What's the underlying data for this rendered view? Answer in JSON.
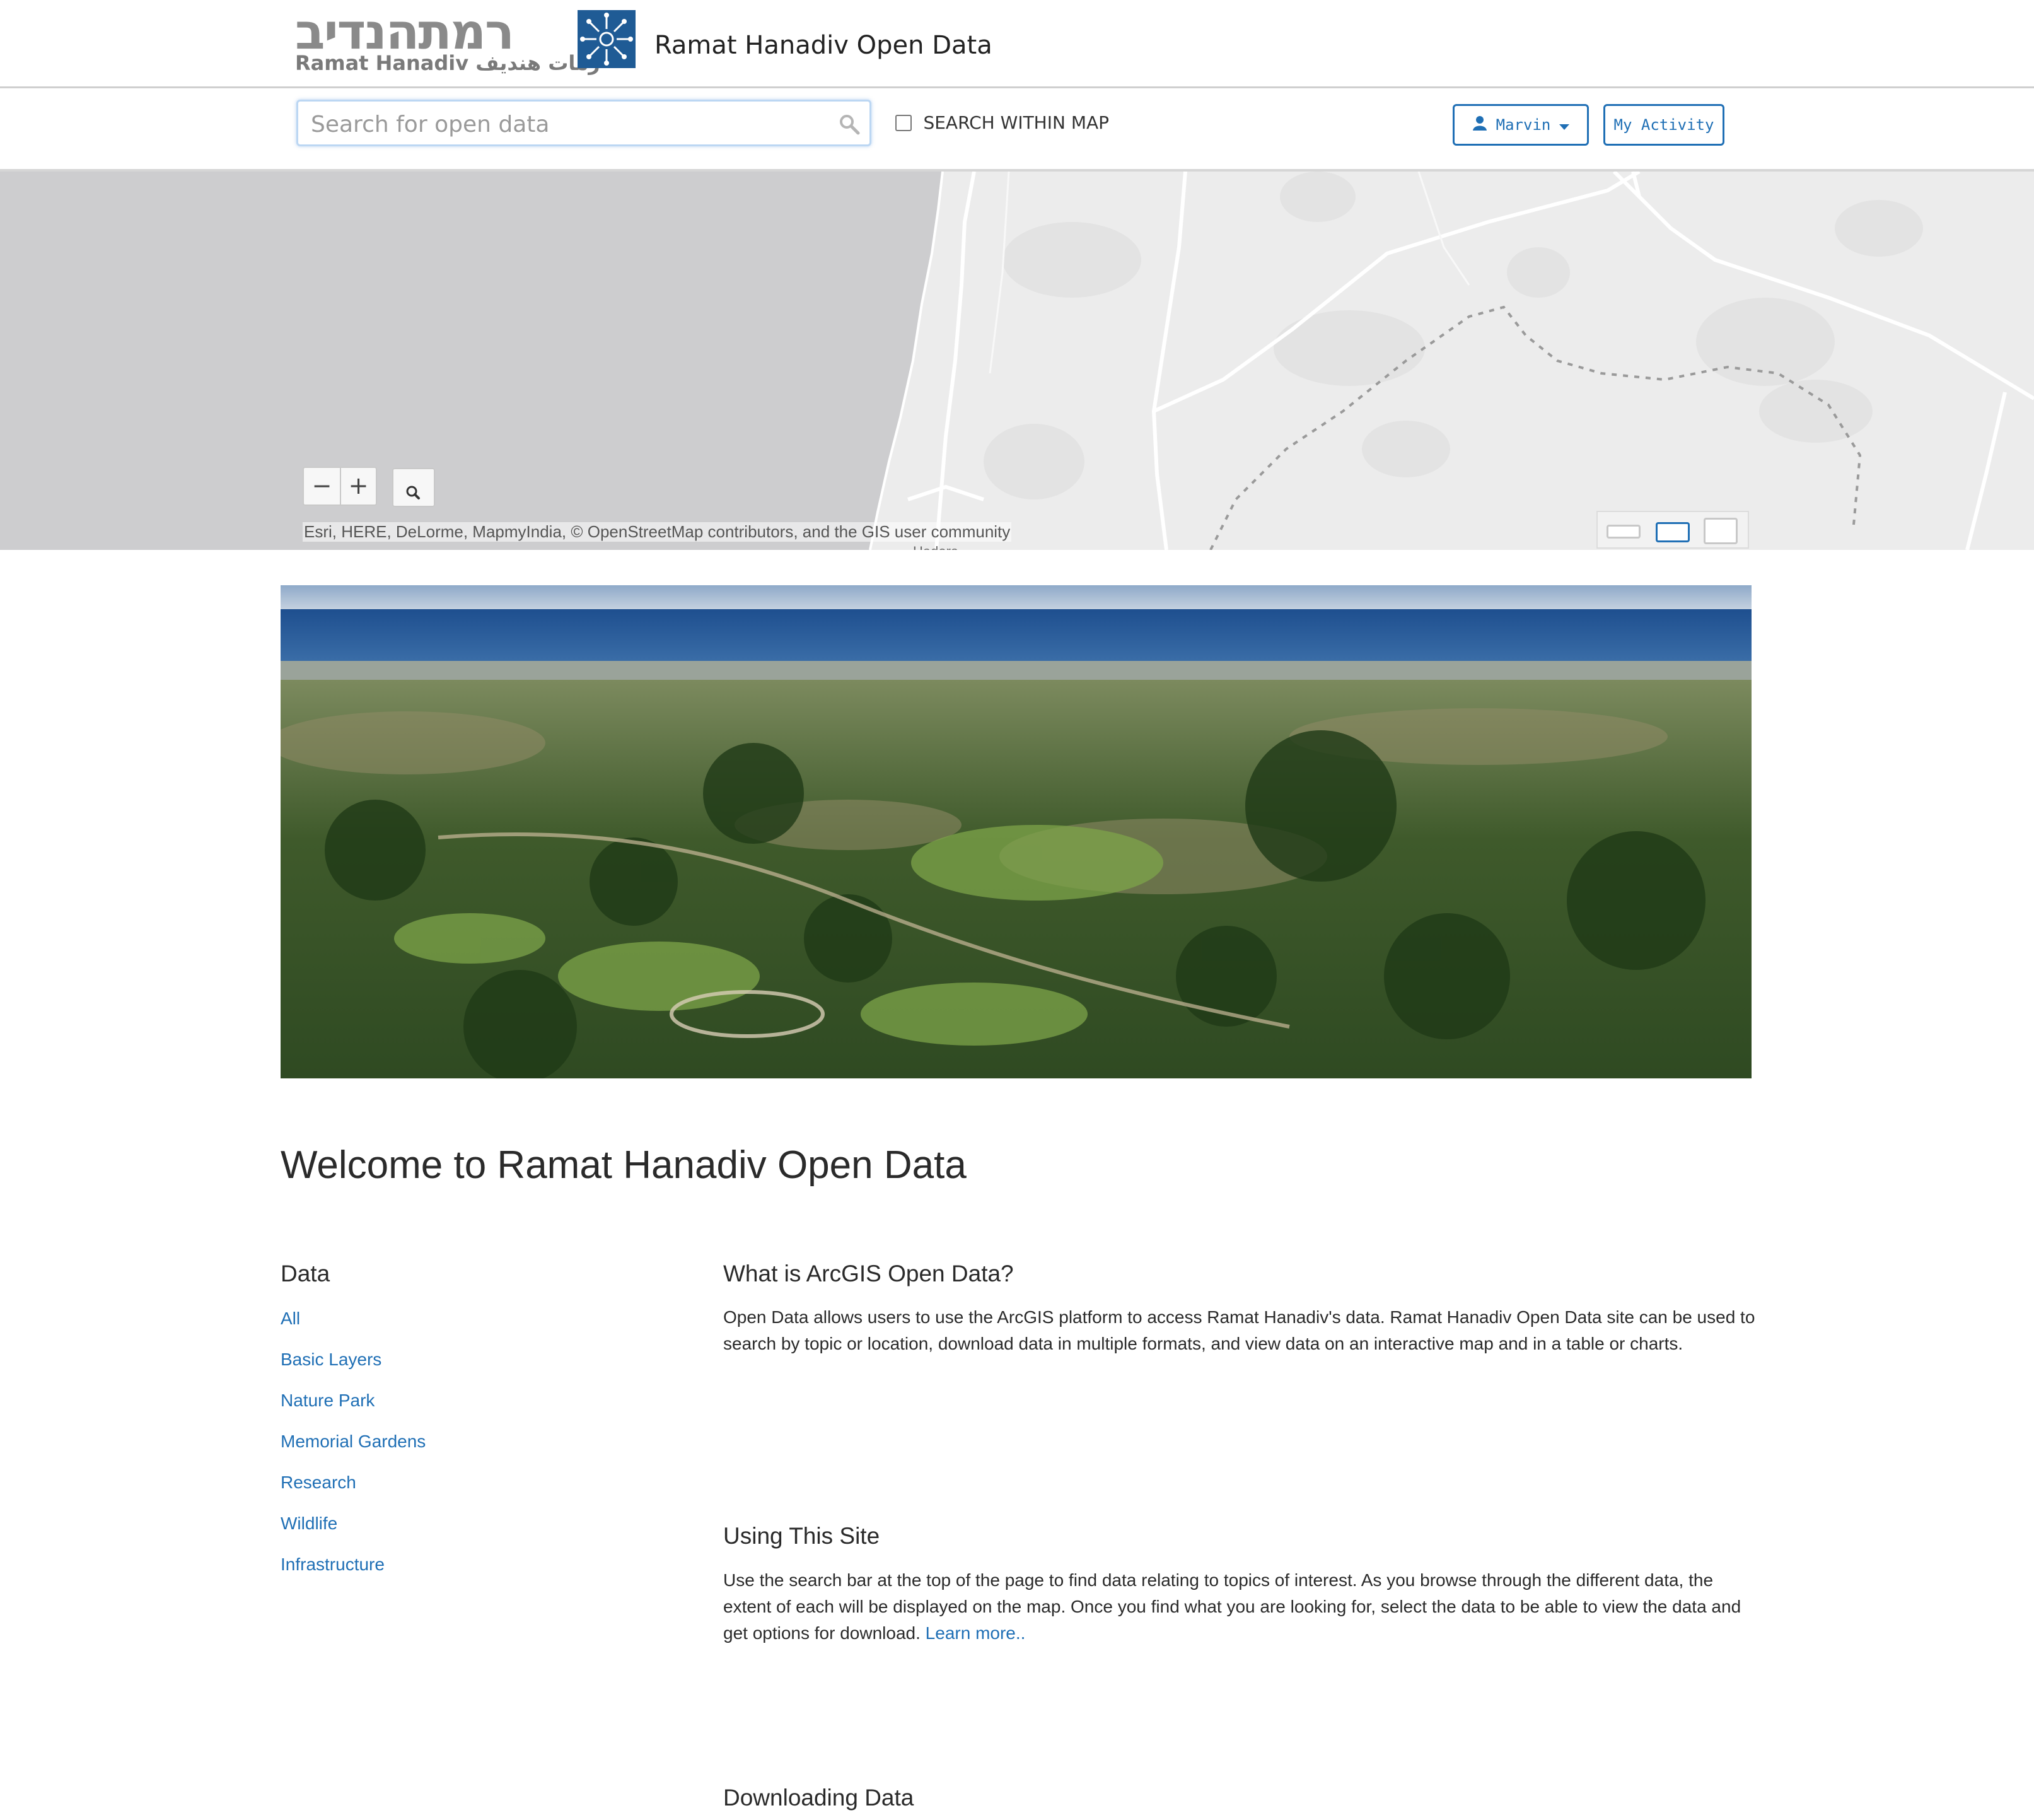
{
  "header": {
    "logo_hebrew": "רמתהנדיב",
    "logo_subtitle": "Ramat Hanadiv رمات هنديف",
    "site_title": "Ramat Hanadiv Open Data"
  },
  "search": {
    "placeholder": "Search for open data",
    "value": "",
    "within_map_label": "SEARCH WITHIN MAP",
    "within_map_checked": false
  },
  "user_menu": {
    "user_label": "Marvin",
    "activity_label": "My Activity"
  },
  "map": {
    "zoom_out_label": "−",
    "zoom_in_label": "+",
    "attribution": "Esri, HERE, DeLorme, MapmyIndia, © OpenStreetMap contributors, and the GIS user community",
    "partial_label": "Hadera"
  },
  "welcome_title": "Welcome to Ramat Hanadiv Open Data",
  "sidebar": {
    "heading": "Data",
    "items": [
      {
        "label": "All"
      },
      {
        "label": "Basic Layers"
      },
      {
        "label": "Nature Park"
      },
      {
        "label": "Memorial Gardens"
      },
      {
        "label": "Research"
      },
      {
        "label": "Wildlife"
      },
      {
        "label": "Infrastructure"
      }
    ]
  },
  "sections": {
    "what_is": {
      "title": "What is ArcGIS Open Data?",
      "body": "Open Data allows users to use the ArcGIS platform to access Ramat Hanadiv's data. Ramat Hanadiv Open Data site can be used to search by topic or location, download data in multiple formats, and view data on an interactive map and in a table or charts."
    },
    "using": {
      "title": "Using This Site",
      "body": "Use the search bar at the top of the page to find data relating to topics of interest. As you browse through the different data, the extent of each will be displayed on the map. Once you find what you are looking for, select the data to be able to view the data and get options for download.",
      "link": "Learn more.."
    },
    "downloading": {
      "title": "Downloading Data"
    }
  },
  "colors": {
    "link": "#1f6fb5",
    "logo_blue": "#1f5b95",
    "sea": "#cdcdcf",
    "land": "#ececec"
  }
}
